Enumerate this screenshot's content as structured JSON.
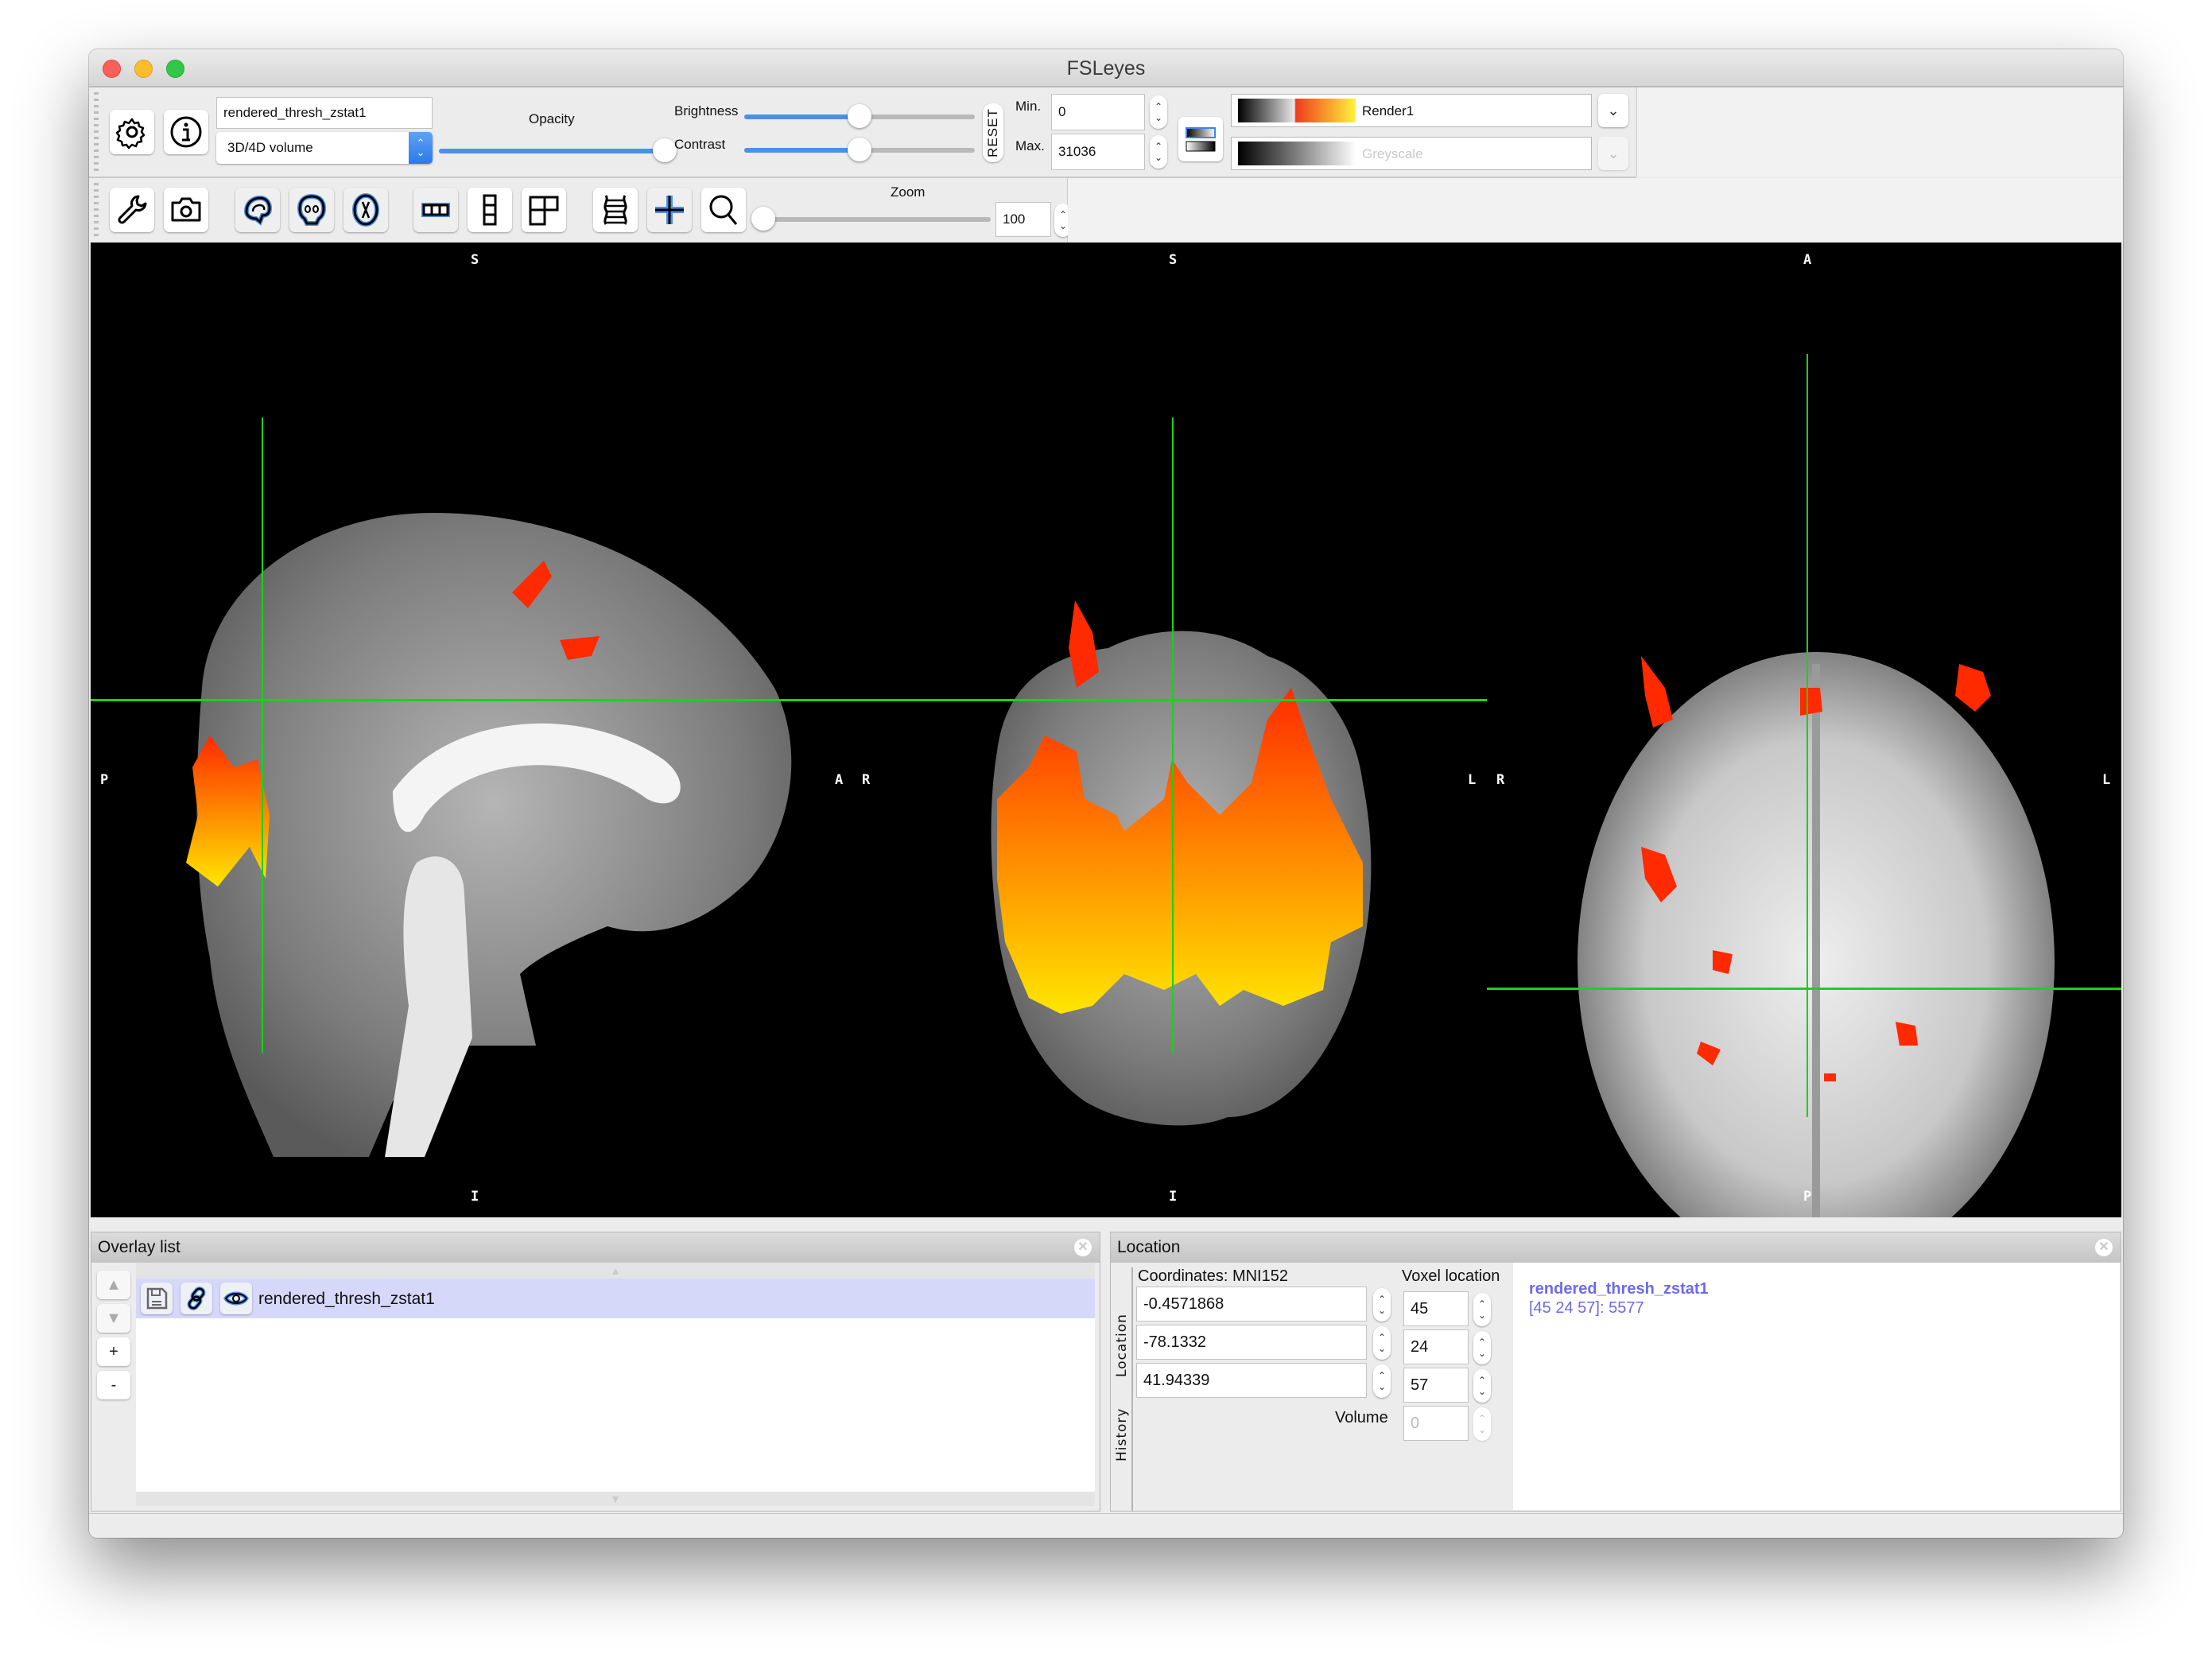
{
  "window": {
    "title": "FSLeyes"
  },
  "overlay_toolbar": {
    "overlay_name": "rendered_thresh_zstat1",
    "overlay_type": "3D/4D volume",
    "opacity_label": "Opacity",
    "opacity_value": 1.0,
    "brightness_label": "Brightness",
    "brightness_value": 0.5,
    "contrast_label": "Contrast",
    "contrast_value": 0.5,
    "reset_label": "RESET",
    "min_label": "Min.",
    "min_value": "0",
    "max_label": "Max.",
    "max_value": "31036",
    "colormap_label": "Render1",
    "negative_colormap_label": "Greyscale",
    "icons": {
      "settings": "gear-icon",
      "info": "info-icon"
    }
  },
  "view_toolbar": {
    "zoom_label": "Zoom",
    "zoom_value": "100",
    "zoom_slider_fraction": 0.0,
    "icons": [
      "wrench-icon",
      "camera-icon",
      "sagittal-icon",
      "coronal-icon",
      "axial-icon",
      "horizontal-layout-icon",
      "vertical-layout-icon",
      "grid-layout-icon",
      "movie-icon",
      "cursor-icon",
      "zoom-icon"
    ]
  },
  "canvas": {
    "sagittal": {
      "top": "S",
      "bottom": "I",
      "left": "P",
      "right": "A"
    },
    "coronal": {
      "top": "S",
      "bottom": "I",
      "left": "R",
      "right": "L"
    },
    "axial": {
      "top": "A",
      "bottom": "P",
      "left": "R",
      "right": "L"
    },
    "crosshair_color": "#19d219"
  },
  "overlay_list": {
    "title": "Overlay list",
    "move_up": "▲",
    "move_down": "▼",
    "add": "+",
    "remove": "-",
    "items": [
      {
        "name": "rendered_thresh_zstat1",
        "selected": true
      }
    ]
  },
  "location_panel": {
    "title": "Location",
    "tab_location": "Location",
    "tab_history": "History",
    "coordinates_label": "Coordinates: MNI152",
    "world_coords": [
      "-0.4571868",
      "-78.1332",
      "41.94339"
    ],
    "voxel_label": "Voxel location",
    "voxel_coords": [
      "45",
      "24",
      "57"
    ],
    "volume_label": "Volume",
    "volume_value": "0",
    "info_name": "rendered_thresh_zstat1",
    "info_value": "[45 24 57]: 5577",
    "info_color": "#6b6bea"
  }
}
